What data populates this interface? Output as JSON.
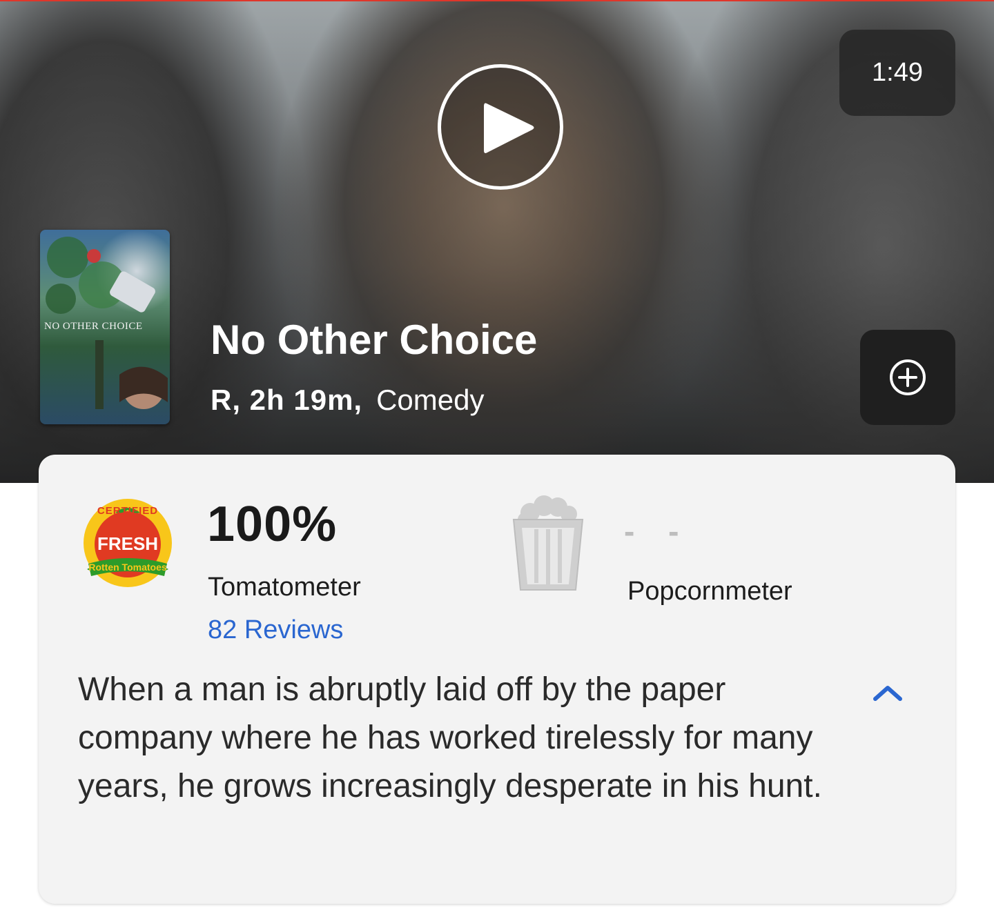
{
  "hero": {
    "duration": "1:49",
    "play_label": "Play trailer",
    "add_label": "Add to watchlist"
  },
  "movie": {
    "poster_title": "NO OTHER CHOICE",
    "title": "No Other Choice",
    "rating_runtime": "R, 2h 19m,",
    "genre": "Comedy"
  },
  "scores": {
    "badge": {
      "top_text": "CERTIFIED",
      "middle_text": "FRESH",
      "bottom_text": "Rotten Tomatoes"
    },
    "tomatometer": {
      "value": "100%",
      "label": "Tomatometer",
      "reviews": "82 Reviews"
    },
    "popcornmeter": {
      "value": "- -",
      "label": "Popcornmeter"
    }
  },
  "synopsis": {
    "text": "When a man is abruptly laid off by the paper company where he has worked tirelessly for many years, he grows increasingly desperate in his hunt."
  },
  "colors": {
    "link_blue": "#2a66d0",
    "certified_red": "#e03a22",
    "certified_yellow": "#f8c61a",
    "certified_green": "#2d9b2a",
    "top_accent": "#e0362a"
  }
}
